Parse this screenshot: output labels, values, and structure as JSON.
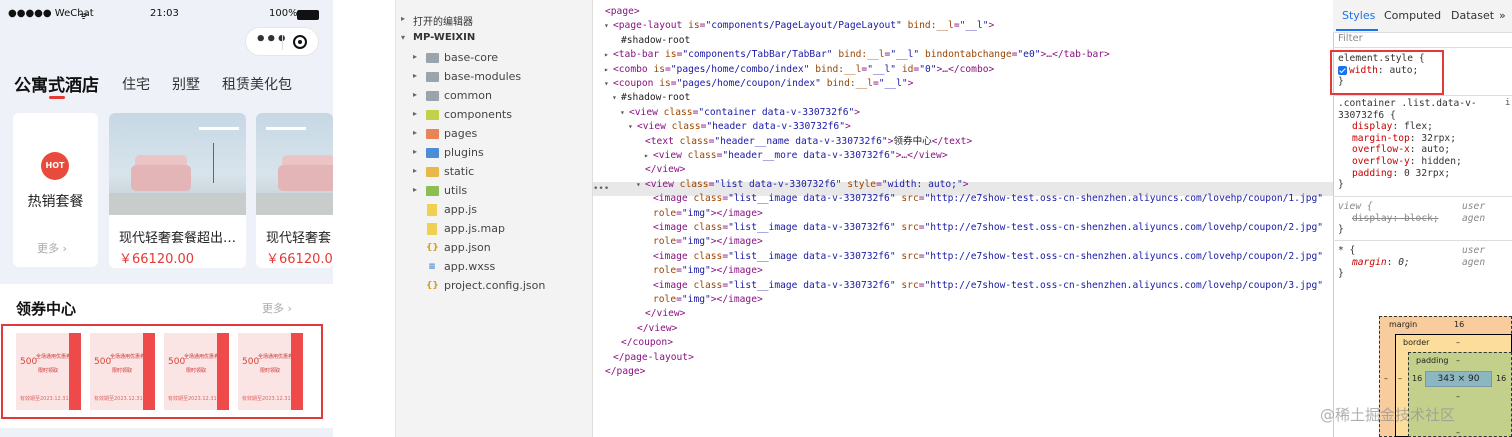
{
  "phone": {
    "status": {
      "carrier": "●●●●● WeChat",
      "wifi": "ᯤ",
      "time": "21:03",
      "battery": "100%"
    },
    "tabs": [
      "公寓式酒店",
      "住宅",
      "别墅",
      "租赁美化包"
    ],
    "hot": {
      "badge": "HOT",
      "label": "热销套餐",
      "more": "更多 ›"
    },
    "rooms": [
      {
        "title": "现代轻奢套餐超出…",
        "price": "￥66120.00"
      },
      {
        "title": "现代轻奢套",
        "price": "￥66120.0"
      }
    ],
    "coupon_section": {
      "title": "领券中心",
      "more": "更多 ›"
    },
    "coupons": [
      {
        "amount": "500",
        "line1": "全场通用优惠券",
        "line2": "限时领取",
        "line3": "有效期至2023.12.31"
      },
      {
        "amount": "500",
        "line1": "全场通用优惠券",
        "line2": "限时领取",
        "line3": "有效期至2023.12.31"
      },
      {
        "amount": "500",
        "line1": "全场通用优惠券",
        "line2": "限时领取",
        "line3": "有效期至2023.12.31"
      },
      {
        "amount": "500",
        "line1": "全场通用优惠券",
        "line2": "限时领取",
        "line3": "有效期至2023.12.31"
      }
    ]
  },
  "tree": {
    "open_editors": "打开的编辑器",
    "project": "MP-WEIXIN",
    "folders": [
      "base-core",
      "base-modules",
      "common",
      "components",
      "pages",
      "plugins",
      "static",
      "utils"
    ],
    "files": [
      "app.js",
      "app.js.map",
      "app.json",
      "app.wxss",
      "project.config.json"
    ]
  },
  "elements": {
    "lines": [
      {
        "open": "<page>"
      },
      {
        "open": "<page-layout",
        "attrs": [
          [
            "is",
            "components/PageLayout/PageLayout"
          ],
          [
            "bind:__l",
            "__l"
          ]
        ],
        "close": ">"
      },
      {
        "text": "#shadow-root"
      },
      {
        "open": "<tab-bar",
        "attrs": [
          [
            "is",
            "components/TabBar/TabBar"
          ],
          [
            "bind:__l",
            "__l"
          ],
          [
            "bindontabchange",
            "e0"
          ]
        ],
        "close": ">…</tab-bar>"
      },
      {
        "open": "<combo",
        "attrs": [
          [
            "is",
            "pages/home/combo/index"
          ],
          [
            "bind:__l",
            "__l"
          ],
          [
            "id",
            "0"
          ]
        ],
        "close": ">…</combo>"
      },
      {
        "open": "<coupon",
        "attrs": [
          [
            "is",
            "pages/home/coupon/index"
          ],
          [
            "bind:__l",
            "__l"
          ]
        ],
        "close": ">"
      },
      {
        "text": "#shadow-root"
      },
      {
        "open": "<view",
        "attrs": [
          [
            "class",
            "container data-v-330732f6"
          ]
        ],
        "close": ">"
      },
      {
        "open": "<view",
        "attrs": [
          [
            "class",
            "header data-v-330732f6"
          ]
        ],
        "close": ">"
      },
      {
        "open": "<text",
        "attrs": [
          [
            "class",
            "header__name data-v-330732f6"
          ]
        ],
        "close": ">",
        "inner": "领券中心",
        "end": "</text>"
      },
      {
        "open": "<view",
        "attrs": [
          [
            "class",
            "header__more data-v-330732f6"
          ]
        ],
        "close": ">…</view>"
      },
      {
        "open": "</view>"
      },
      {
        "open": "<view",
        "attrs": [
          [
            "class",
            "list data-v-330732f6"
          ],
          [
            "style",
            "width: auto;"
          ]
        ],
        "close": ">"
      },
      {
        "open": "<image",
        "attrs": [
          [
            "class",
            "list__image data-v-330732f6"
          ],
          [
            "src",
            "http://e7show-test.oss-cn-shenzhen.aliyuncs.com/lovehp/coupon/1.jpg"
          ]
        ]
      },
      {
        "attrs": [
          [
            "role",
            "img"
          ]
        ],
        "close": "></image>"
      },
      {
        "open": "<image",
        "attrs": [
          [
            "class",
            "list__image data-v-330732f6"
          ],
          [
            "src",
            "http://e7show-test.oss-cn-shenzhen.aliyuncs.com/lovehp/coupon/2.jpg"
          ]
        ]
      },
      {
        "attrs": [
          [
            "role",
            "img"
          ]
        ],
        "close": "></image>"
      },
      {
        "open": "<image",
        "attrs": [
          [
            "class",
            "list__image data-v-330732f6"
          ],
          [
            "src",
            "http://e7show-test.oss-cn-shenzhen.aliyuncs.com/lovehp/coupon/2.jpg"
          ]
        ]
      },
      {
        "attrs": [
          [
            "role",
            "img"
          ]
        ],
        "close": "></image>"
      },
      {
        "open": "<image",
        "attrs": [
          [
            "class",
            "list__image data-v-330732f6"
          ],
          [
            "src",
            "http://e7show-test.oss-cn-shenzhen.aliyuncs.com/lovehp/coupon/3.jpg"
          ]
        ]
      },
      {
        "attrs": [
          [
            "role",
            "img"
          ]
        ],
        "close": "></image>"
      },
      {
        "open": "</view>"
      },
      {
        "open": "</view>"
      },
      {
        "open": "</coupon>"
      },
      {
        "open": "</page-layout>"
      },
      {
        "open": "</page>"
      }
    ],
    "gutter": "•••"
  },
  "styles": {
    "tabs": [
      "Styles",
      "Computed",
      "Dataset",
      "»"
    ],
    "filter": "Filter",
    "element_style": {
      "selector": "element.style {",
      "prop": "width",
      "value": "auto;",
      "close": "}"
    },
    "rule1": {
      "selector": ".container .list.data-v-330732f6 {",
      "link": "i",
      "props": [
        [
          "display",
          "flex;"
        ],
        [
          "margin-top",
          "32rpx;"
        ],
        [
          "overflow-x",
          "auto;"
        ],
        [
          "overflow-y",
          "hidden;"
        ],
        [
          "padding",
          "0 32rpx;"
        ]
      ],
      "close": "}"
    },
    "rule2": {
      "selector": "view {",
      "source": "user agen",
      "prop": "display",
      "value": "block;",
      "close": "}"
    },
    "rule3": {
      "selector": "* {",
      "source": "user agen",
      "prop": "margin",
      "value": "0;",
      "close": "}"
    },
    "box": {
      "margin_label": "margin",
      "margin_top": "16",
      "margin_left": "–",
      "margin_bottom": "–",
      "border_label": "border",
      "border_val": "–",
      "padding_label": "padding",
      "padding_val": "–",
      "padding_left": "16",
      "padding_right": "16",
      "content": "343 × 90",
      "padding_bottom": "–"
    },
    "watermark": "@稀土掘金技术社区"
  },
  "colors": {
    "accent": "#1a73e8",
    "price": "#e53935",
    "highlight": "#e23a3a"
  }
}
